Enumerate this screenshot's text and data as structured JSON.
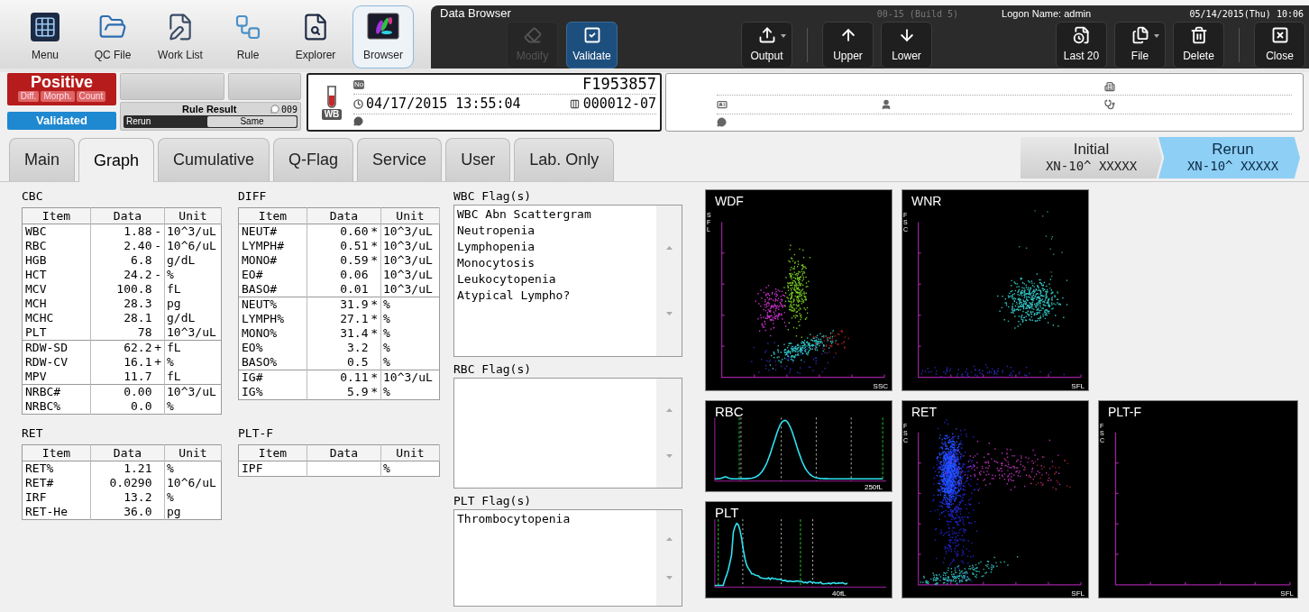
{
  "toolbar": [
    {
      "label": "Menu",
      "selected": false
    },
    {
      "label": "QC File",
      "selected": false
    },
    {
      "label": "Work List",
      "selected": false
    },
    {
      "label": "Rule",
      "selected": false
    },
    {
      "label": "Explorer",
      "selected": false
    },
    {
      "label": "Browser",
      "selected": true
    }
  ],
  "window": {
    "title": "Data Browser",
    "build": "00-15 (Build 5)",
    "logon": "Logon Name: admin",
    "datetime": "05/14/2015(Thu) 10:06"
  },
  "actions": [
    {
      "label": "Modify",
      "disabled": true,
      "selected": false,
      "dropdown": false
    },
    {
      "label": "Validate",
      "disabled": false,
      "selected": true,
      "dropdown": false
    },
    {
      "label": "Output",
      "disabled": false,
      "selected": false,
      "dropdown": true
    },
    {
      "label": "Upper",
      "disabled": false,
      "selected": false,
      "dropdown": false
    },
    {
      "label": "Lower",
      "disabled": false,
      "selected": false,
      "dropdown": false
    },
    {
      "label": "Last 20",
      "disabled": false,
      "selected": false,
      "dropdown": false
    },
    {
      "label": "File",
      "disabled": false,
      "selected": false,
      "dropdown": true
    },
    {
      "label": "Delete",
      "disabled": false,
      "selected": false,
      "dropdown": false
    },
    {
      "label": "Close",
      "disabled": false,
      "selected": false,
      "dropdown": false
    }
  ],
  "status": {
    "judgment": "Positive",
    "tags": [
      "Diff.",
      "Morph.",
      "Count"
    ],
    "validation": "Validated",
    "rule_result": {
      "label": "Rule Result",
      "comment_count": "009",
      "left": "Rerun",
      "right": "Same"
    }
  },
  "sample": {
    "tube": "WB",
    "number_label": "No",
    "number": "F1953857",
    "datetime": "04/17/2015 13:55:04",
    "rack": "000012-07"
  },
  "tabs": [
    {
      "label": "Main",
      "selected": false
    },
    {
      "label": "Graph",
      "selected": true
    },
    {
      "label": "Cumulative",
      "selected": false
    },
    {
      "label": "Q-Flag",
      "selected": false
    },
    {
      "label": "Service",
      "selected": false
    },
    {
      "label": "User",
      "selected": false
    },
    {
      "label": "Lab. Only",
      "selected": false
    }
  ],
  "runs": [
    {
      "label": "Initial",
      "model": "XN-10^ XXXXX",
      "selected": false
    },
    {
      "label": "Rerun",
      "model": "XN-10^ XXXXX",
      "selected": true
    }
  ],
  "tables": [
    {
      "title": "CBC",
      "columns": [
        "Item",
        "Data",
        "Unit"
      ],
      "groups": [
        [
          {
            "item": "WBC",
            "data": "1.88",
            "flag": "-",
            "unit": "10^3/uL"
          },
          {
            "item": "RBC",
            "data": "2.40",
            "flag": "-",
            "unit": "10^6/uL"
          },
          {
            "item": "HGB",
            "data": "6.8",
            "unit": "g/dL"
          },
          {
            "item": "HCT",
            "data": "24.2",
            "flag": "-",
            "unit": "%"
          },
          {
            "item": "MCV",
            "data": "100.8",
            "unit": "fL"
          },
          {
            "item": "MCH",
            "data": "28.3",
            "unit": "pg"
          },
          {
            "item": "MCHC",
            "data": "28.1",
            "unit": "g/dL"
          },
          {
            "item": "PLT",
            "data": "78",
            "unit": "10^3/uL"
          }
        ],
        [
          {
            "item": "RDW-SD",
            "data": "62.2",
            "flag": "+",
            "unit": "fL"
          },
          {
            "item": "RDW-CV",
            "data": "16.1",
            "flag": "+",
            "unit": "%"
          },
          {
            "item": "MPV",
            "data": "11.7",
            "unit": "fL"
          }
        ],
        [
          {
            "item": "NRBC#",
            "data": "0.00",
            "unit": "10^3/uL"
          },
          {
            "item": "NRBC%",
            "data": "0.0",
            "unit": "%"
          }
        ]
      ]
    },
    {
      "title": "DIFF",
      "columns": [
        "Item",
        "Data",
        "Unit"
      ],
      "groups": [
        [
          {
            "item": "NEUT#",
            "data": "0.60",
            "flag": "*",
            "unit": "10^3/uL"
          },
          {
            "item": "LYMPH#",
            "data": "0.51",
            "flag": "*",
            "unit": "10^3/uL"
          },
          {
            "item": "MONO#",
            "data": "0.59",
            "flag": "*",
            "unit": "10^3/uL"
          },
          {
            "item": "EO#",
            "data": "0.06",
            "unit": "10^3/uL"
          },
          {
            "item": "BASO#",
            "data": "0.01",
            "unit": "10^3/uL"
          }
        ],
        [
          {
            "item": "NEUT%",
            "data": "31.9",
            "flag": "*",
            "unit": "%"
          },
          {
            "item": "LYMPH%",
            "data": "27.1",
            "flag": "*",
            "unit": "%"
          },
          {
            "item": "MONO%",
            "data": "31.4",
            "flag": "*",
            "unit": "%"
          },
          {
            "item": "EO%",
            "data": "3.2",
            "unit": "%"
          },
          {
            "item": "BASO%",
            "data": "0.5",
            "unit": "%"
          }
        ],
        [
          {
            "item": "IG#",
            "data": "0.11",
            "flag": "*",
            "unit": "10^3/uL"
          },
          {
            "item": "IG%",
            "data": "5.9",
            "flag": "*",
            "unit": "%"
          }
        ]
      ]
    },
    {
      "title": "RET",
      "columns": [
        "Item",
        "Data",
        "Unit"
      ],
      "groups": [
        [
          {
            "item": "RET%",
            "data": "1.21",
            "unit": "%"
          },
          {
            "item": "RET#",
            "data": "0.0290",
            "unit": "10^6/uL"
          },
          {
            "item": "IRF",
            "data": "13.2",
            "unit": "%"
          },
          {
            "item": "RET-He",
            "data": "36.0",
            "unit": "pg"
          }
        ]
      ]
    },
    {
      "title": "PLT-F",
      "columns": [
        "Item",
        "Data",
        "Unit"
      ],
      "groups": [
        [
          {
            "item": "IPF",
            "unit": "%"
          }
        ]
      ]
    }
  ],
  "flags": [
    {
      "title": "WBC Flag(s)",
      "items": [
        "WBC Abn Scattergram",
        "Neutropenia",
        "Lymphopenia",
        "Monocytosis",
        "Leukocytopenia",
        "Atypical Lympho?"
      ]
    },
    {
      "title": "RBC Flag(s)"
    },
    {
      "title": "PLT Flag(s)",
      "items": [
        "Thrombocytopenia"
      ]
    }
  ],
  "graphs": [
    {
      "kind": "scatter",
      "title": "WDF",
      "y_axis": "SFL",
      "x_axis": "SSC"
    },
    {
      "kind": "scatter",
      "title": "WNR",
      "y_axis": "FSC",
      "x_axis": "SFL"
    },
    {
      "kind": "histogram",
      "title": "RBC",
      "x_axis": "250fL"
    },
    {
      "kind": "histogram",
      "title": "PLT",
      "x_axis": "40fL"
    },
    {
      "kind": "scatter",
      "title": "RET",
      "y_axis": "FSC",
      "x_axis": "SFL"
    },
    {
      "kind": "scatter",
      "title": "PLT-F",
      "y_axis": "FSC",
      "x_axis": "SFL"
    }
  ]
}
